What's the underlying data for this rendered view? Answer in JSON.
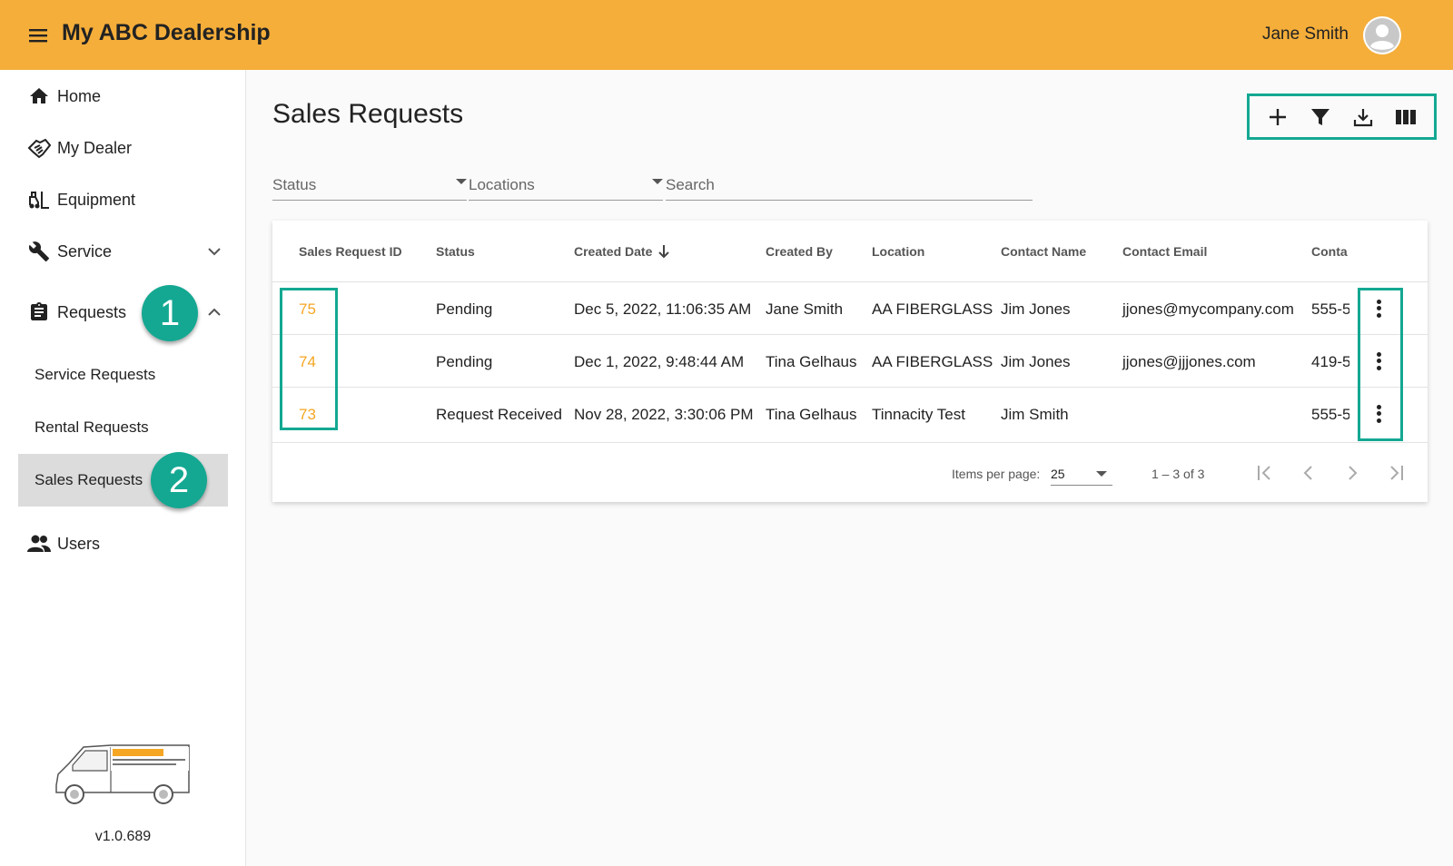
{
  "header": {
    "title": "My ABC Dealership",
    "user_name": "Jane Smith",
    "brand_color": "#f5ae3a"
  },
  "sidebar": {
    "items": [
      {
        "label": "Home",
        "icon": "home-icon"
      },
      {
        "label": "My Dealer",
        "icon": "handshake-icon"
      },
      {
        "label": "Equipment",
        "icon": "forklift-icon"
      },
      {
        "label": "Service",
        "icon": "wrench-icon",
        "expanded": false
      },
      {
        "label": "Requests",
        "icon": "clipboard-icon",
        "expanded": true
      },
      {
        "label": "Users",
        "icon": "users-icon"
      }
    ],
    "sub_items": [
      {
        "label": "Service Requests",
        "active": false
      },
      {
        "label": "Rental Requests",
        "active": false
      },
      {
        "label": "Sales Requests",
        "active": true
      }
    ],
    "logo_icon": "dealership-van-logo",
    "version": "v1.0.689"
  },
  "callouts": {
    "one": "1",
    "two": "2",
    "color": "#14a892"
  },
  "main": {
    "title": "Sales Requests",
    "toolbar": [
      "add-icon",
      "filter-icon",
      "download-icon",
      "columns-icon"
    ],
    "filters": {
      "status": "Status",
      "locations": "Locations",
      "search": "Search"
    }
  },
  "table": {
    "columns": [
      "Sales Request ID",
      "Status",
      "Created Date",
      "Created By",
      "Location",
      "Contact Name",
      "Contact Email",
      "Conta"
    ],
    "sort_column": "Created Date",
    "sort_direction": "descending",
    "rows": [
      {
        "id": "75",
        "status": "Pending",
        "created": "Dec 5, 2022, 11:06:35 AM",
        "by": "Jane Smith",
        "location": "AA FIBERGLASS",
        "contact": "Jim Jones",
        "email": "jjones@mycompany.com",
        "phone": "555-5"
      },
      {
        "id": "74",
        "status": "Pending",
        "created": "Dec 1, 2022, 9:48:44 AM",
        "by": "Tina Gelhaus",
        "location": "AA FIBERGLASS",
        "contact": "Jim Jones",
        "email": "jjones@jjjones.com",
        "phone": "419-5"
      },
      {
        "id": "73",
        "status": "Request Received",
        "created": "Nov 28, 2022, 3:30:06 PM",
        "by": "Tina Gelhaus",
        "location": "Tinnacity Test",
        "contact": "Jim Smith",
        "email": "",
        "phone": "555-5"
      }
    ]
  },
  "paginator": {
    "items_per_page_label": "Items per page:",
    "items_per_page": "25",
    "range": "1 – 3 of 3"
  }
}
